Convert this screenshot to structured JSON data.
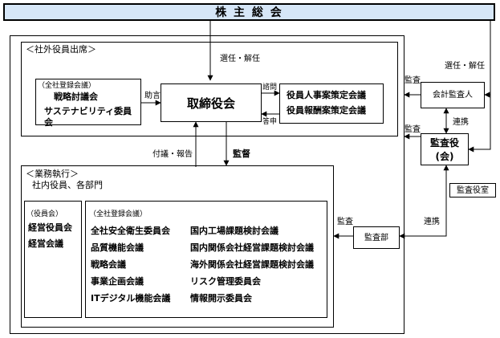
{
  "shareholders_meeting": "株 主 総 会",
  "outside_officers_label": "＜社外役員出席＞",
  "advisory": {
    "header": "（全社登録会議）",
    "items": [
      "戦略討議会",
      "サステナビリティ委員会"
    ]
  },
  "board": "取締役会",
  "nomination": [
    "役員人事案策定会議",
    "役員報酬案策定会議"
  ],
  "audit_firm": "会計監査人",
  "audit_board": "監査役(会)",
  "audit_office": "監査役室",
  "audit_dept": "監査部",
  "execution": {
    "label": "＜業務執行＞",
    "sublabel": "社内役員、各部門",
    "officers_header": "（役員会）",
    "officers_items": [
      "経営役員会",
      "経営会議"
    ],
    "meetings_header": "（全社登録会議）",
    "meetings_col1": [
      "全社安全衛生委員会",
      "品質機能会議",
      "戦略会議",
      "事業企画会議",
      "ITデジタル機能会議"
    ],
    "meetings_col2": [
      "国内工場課題検討会議",
      "国内関係会社経営課題検討会議",
      "海外関係会社経営課題検討会議",
      "リスク管理委員会",
      "情報開示委員会"
    ]
  },
  "edge_labels": {
    "appoint_dismiss_board": "選任・解任",
    "appoint_dismiss_auditors": "選任・解任",
    "advice": "助言",
    "consult": "諮問",
    "report": "答申",
    "proposal_report": "付議・報告",
    "supervision": "監督",
    "audit_to_firm": "監査",
    "audit_to_board": "監査",
    "coordination_firm": "連携",
    "coordination_dept": "連携",
    "audit_dept_audit": "監査"
  },
  "colors": {
    "header_fill": "#d6e6f7",
    "line": "#000000"
  }
}
